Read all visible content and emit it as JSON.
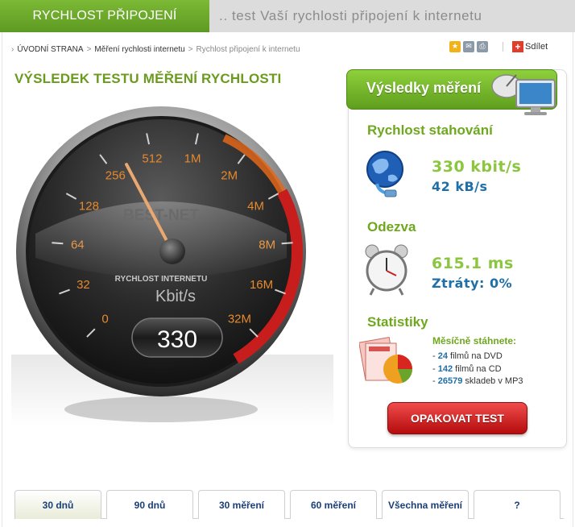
{
  "header": {
    "tab_label": "RYCHLOST PŘIPOJENÍ",
    "subtitle": ".. test Vaší rychlosti připojení k internetu"
  },
  "breadcrumb": {
    "items": [
      "ÚVODNÍ STRANA",
      "Měření rychlosti internetu"
    ],
    "current": "Rychlost připojení k internetu"
  },
  "share": {
    "label": "Sdílet"
  },
  "page_title": "VÝSLEDEK TESTU MĚŘENÍ RYCHLOSTI",
  "gauge": {
    "scale_labels": [
      "0",
      "32",
      "64",
      "128",
      "256",
      "512",
      "1M",
      "2M",
      "4M",
      "8M",
      "16M",
      "32M"
    ],
    "brand": "BEST-NET",
    "caption": "RYCHLOST INTERNETU",
    "unit": "Kbit/s",
    "value": "330",
    "needle_value": 330
  },
  "results": {
    "panel_title": "Výsledky měření",
    "download": {
      "title": "Rychlost stahování",
      "kbit": "330 kbit/s",
      "kB": "42 kB/s"
    },
    "ping": {
      "title": "Odezva",
      "ms": "615.1 ms",
      "loss": "Ztráty: 0%"
    },
    "stats": {
      "title": "Statistiky",
      "heading": "Měsíčně stáhnete:",
      "lines": [
        {
          "dash": "- ",
          "count": "24",
          "text": " filmů na DVD"
        },
        {
          "dash": "- ",
          "count": "142",
          "text": " filmů na CD"
        },
        {
          "dash": "- ",
          "count": "26579",
          "text": " skladeb v MP3"
        }
      ]
    },
    "repeat_button": "OPAKOVAT TEST"
  },
  "tabs": [
    {
      "label": "30 dnů",
      "active": true
    },
    {
      "label": "90 dnů",
      "active": false
    },
    {
      "label": "30 měření",
      "active": false
    },
    {
      "label": "60 měření",
      "active": false
    },
    {
      "label": "Všechna měření",
      "active": false
    },
    {
      "label": "?",
      "active": false
    }
  ],
  "colors": {
    "brand_green": "#6aa42a",
    "title_green": "#6a9b1e",
    "value_blue": "#1f6fa8",
    "button_red": "#d42020"
  }
}
